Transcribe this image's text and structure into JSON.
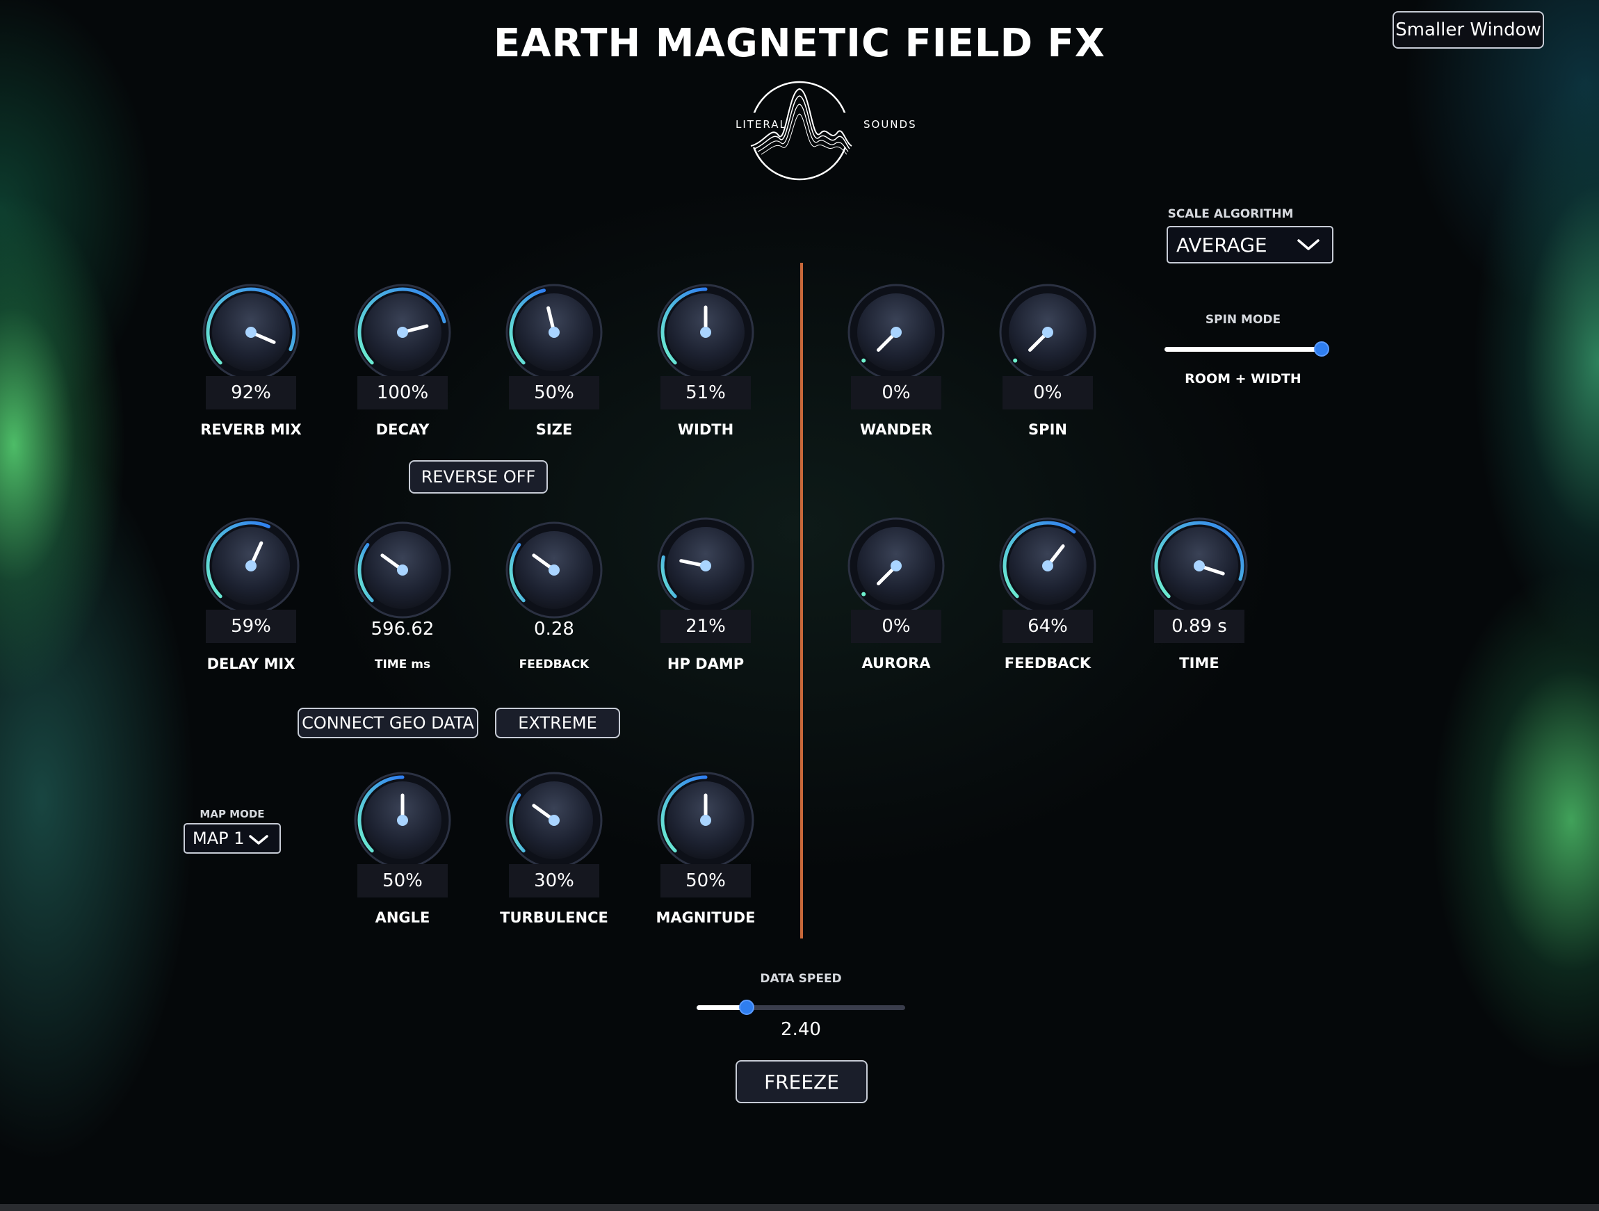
{
  "header": {
    "title": "EARTH MAGNETIC FIELD FX",
    "logo_left": "LITERAL",
    "logo_right": "SOUNDS",
    "smaller_window_label": "Smaller Window"
  },
  "knobs": [
    {
      "key": "reverb_mix",
      "value": "92%",
      "label": "REVERB MIX",
      "level": 0.92
    },
    {
      "key": "decay",
      "value": "100%",
      "label": "DECAY",
      "level": 0.78
    },
    {
      "key": "size",
      "value": "50%",
      "label": "SIZE",
      "level": 0.45
    },
    {
      "key": "width",
      "value": "51%",
      "label": "WIDTH",
      "level": 0.5
    },
    {
      "key": "wander",
      "value": "0%",
      "label": "WANDER",
      "level": 0.0
    },
    {
      "key": "spin",
      "value": "0%",
      "label": "SPIN",
      "level": 0.0
    },
    {
      "key": "delay_mix",
      "value": "59%",
      "label": "DELAY MIX",
      "level": 0.59
    },
    {
      "key": "time_ms",
      "value": "596.62",
      "label": "TIME ms",
      "level": 0.3
    },
    {
      "key": "feedback_left",
      "value": "0.28",
      "label": "FEEDBACK",
      "level": 0.3
    },
    {
      "key": "hp_damp",
      "value": "21%",
      "label": "HP DAMP",
      "level": 0.21
    },
    {
      "key": "aurora",
      "value": "0%",
      "label": "AURORA",
      "level": 0.0
    },
    {
      "key": "feedback_right",
      "value": "64%",
      "label": "FEEDBACK",
      "level": 0.64
    },
    {
      "key": "time",
      "value": "0.89 s",
      "label": "TIME",
      "level": 0.9
    },
    {
      "key": "angle",
      "value": "50%",
      "label": "ANGLE",
      "level": 0.5
    },
    {
      "key": "turbulence",
      "value": "30%",
      "label": "TURBULENCE",
      "level": 0.3
    },
    {
      "key": "magnitude",
      "value": "50%",
      "label": "MAGNITUDE",
      "level": 0.5
    }
  ],
  "buttons": {
    "reverse": "REVERSE OFF",
    "connect_geo": "CONNECT GEO DATA",
    "extreme": "EXTREME",
    "freeze": "FREEZE"
  },
  "scale_algorithm": {
    "label": "SCALE ALGORITHM",
    "selected": "AVERAGE"
  },
  "spin_mode": {
    "label": "SPIN MODE",
    "value_text": "ROOM + WIDTH",
    "level": 1.0
  },
  "map_mode": {
    "label": "MAP MODE",
    "selected": "MAP 1"
  },
  "data_speed": {
    "label": "DATA SPEED",
    "value": "2.40",
    "level": 0.24
  },
  "colors": {
    "accent": "#2f7ef0",
    "teal": "#5ee3c8",
    "divider": "#c8683a",
    "background": "#05080a"
  }
}
